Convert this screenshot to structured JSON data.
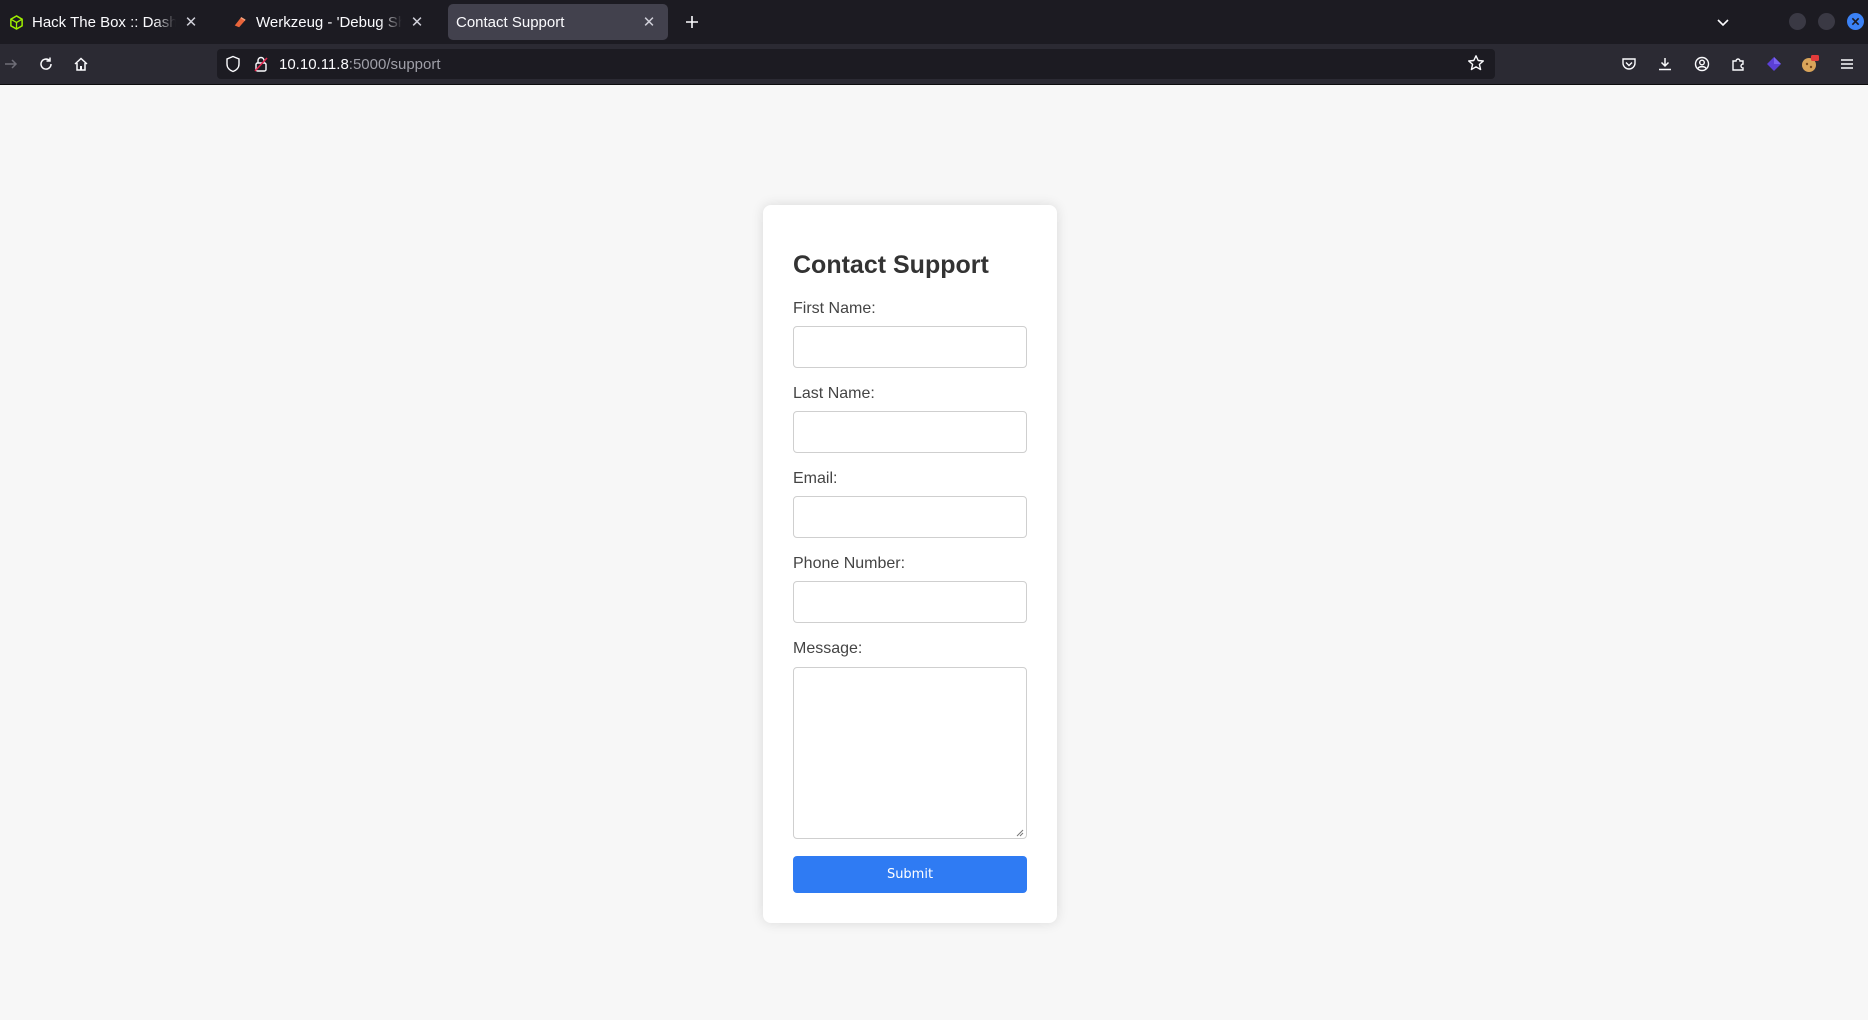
{
  "browser": {
    "tabs": [
      {
        "title": "Hack The Box :: Dashboard",
        "favicon": "htb-cube-icon",
        "active": false
      },
      {
        "title": "Werkzeug - 'Debug Shell'",
        "favicon": "werkzeug-icon",
        "active": false
      },
      {
        "title": "Contact Support",
        "favicon": "",
        "active": true
      }
    ],
    "url_host": "10.10.11.8",
    "url_path": ":5000/support",
    "accent_color": "#3b82f6"
  },
  "form": {
    "heading": "Contact Support",
    "labels": {
      "first_name": "First Name:",
      "last_name": "Last Name:",
      "email": "Email:",
      "phone": "Phone Number:",
      "message": "Message:"
    },
    "values": {
      "first_name": "",
      "last_name": "",
      "email": "",
      "phone": "",
      "message": ""
    },
    "submit_label": "Submit",
    "submit_color": "#2f7bf3"
  }
}
